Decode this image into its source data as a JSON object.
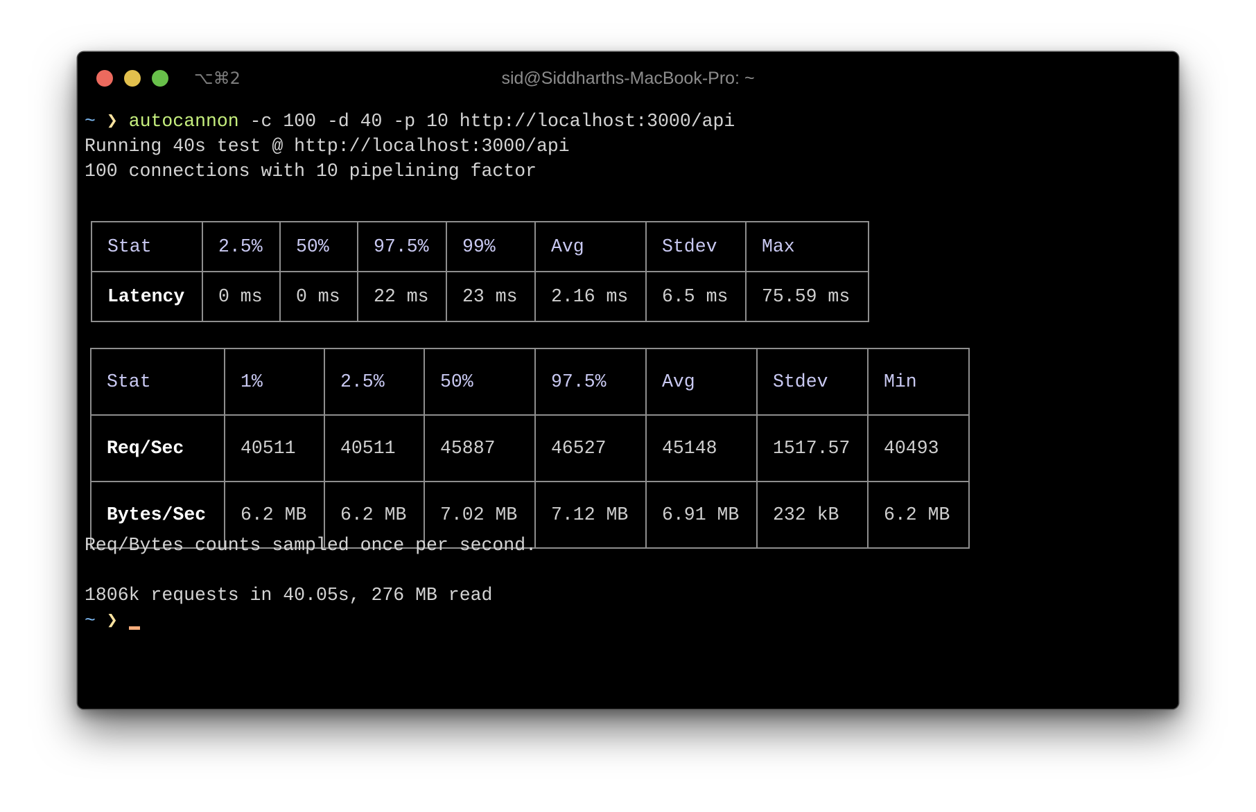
{
  "window": {
    "title": "sid@Siddharths-MacBook-Pro: ~",
    "shortcut": "⌥⌘2",
    "traffic_lights": {
      "close": "#ec6a5e",
      "minimize": "#e2c04d",
      "zoom": "#68c04a"
    }
  },
  "terminal": {
    "prompt": {
      "tilde": "~",
      "chevron": "❯"
    },
    "command": {
      "program": "autocannon",
      "args": "-c 100 -d 40 -p 10 http://localhost:3000/api"
    },
    "output_lines": [
      "Running 40s test @ http://localhost:3000/api",
      "100 connections with 10 pipelining factor"
    ],
    "latency_table": {
      "headers": [
        "Stat",
        "2.5%",
        "50%",
        "97.5%",
        "99%",
        "Avg",
        "Stdev",
        "Max"
      ],
      "rows": [
        [
          "Latency",
          "0 ms",
          "0 ms",
          "22 ms",
          "23 ms",
          "2.16 ms",
          "6.5 ms",
          "75.59 ms"
        ]
      ]
    },
    "throughput_table": {
      "headers": [
        "Stat",
        "1%",
        "2.5%",
        "50%",
        "97.5%",
        "Avg",
        "Stdev",
        "Min"
      ],
      "rows": [
        [
          "Req/Sec",
          "40511",
          "40511",
          "45887",
          "46527",
          "45148",
          "1517.57",
          "40493"
        ],
        [
          "Bytes/Sec",
          "6.2 MB",
          "6.2 MB",
          "7.02 MB",
          "7.12 MB",
          "6.91 MB",
          "232 kB",
          "6.2 MB"
        ]
      ]
    },
    "note": "Req/Bytes counts sampled once per second.",
    "summary": "1806k requests in 40.05s, 276 MB read",
    "colors": {
      "prompt_tilde": "#7cb7f0",
      "prompt_chevron": "#fbe3a0",
      "command": "#c6ef7e",
      "table_header": "#c9c9f2",
      "cursor": "#f6ad7b"
    }
  }
}
